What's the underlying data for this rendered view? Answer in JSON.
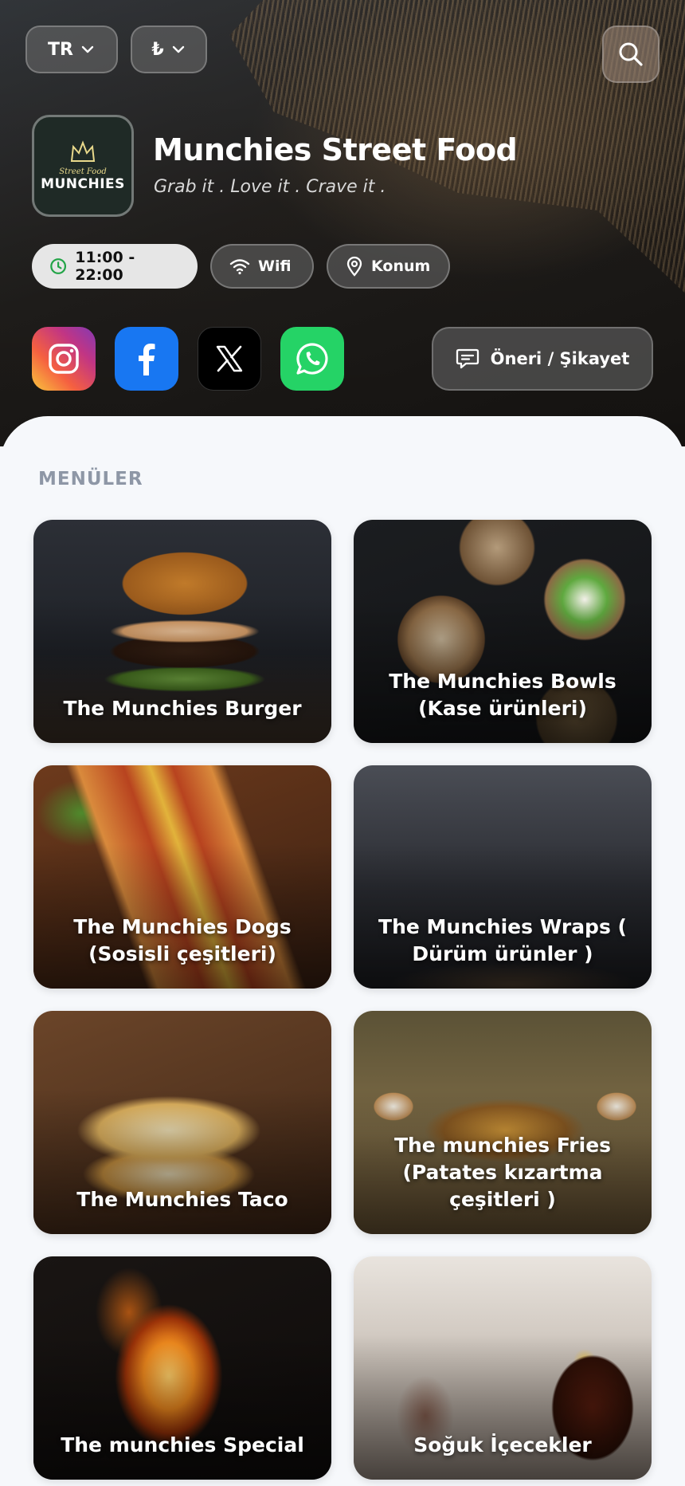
{
  "header": {
    "language_label": "TR",
    "currency_label": "₺",
    "restaurant_name": "Munchies Street Food",
    "tagline": "Grab it . Love it . Crave it .",
    "logo": {
      "small_text": "Street Food",
      "main_text": "MUNCHIES"
    }
  },
  "info_buttons": {
    "hours": "11:00 - 22:00",
    "wifi": "Wifi",
    "location": "Konum"
  },
  "social": {
    "icons": [
      "instagram-icon",
      "facebook-icon",
      "x-icon",
      "whatsapp-icon"
    ],
    "feedback_label": "Öneri / Şikayet"
  },
  "menu_section": {
    "title": "MENÜLER",
    "categories": [
      {
        "label": "The Munchies Burger"
      },
      {
        "label": "The Munchies Bowls (Kase ürünleri)"
      },
      {
        "label": "The Munchies Dogs (Sosisli çeşitleri)"
      },
      {
        "label": "The Munchies Wraps ( Dürüm ürünler )"
      },
      {
        "label": "The Munchies Taco"
      },
      {
        "label": "The munchies Fries (Patates kızartma çeşitleri )"
      },
      {
        "label": "The munchies Special"
      },
      {
        "label": "Soğuk İçecekler"
      }
    ]
  },
  "colors": {
    "page_background": "#f6f8fb",
    "section_title": "#8e97a6",
    "hours_icon": "#22a447",
    "facebook": "#1877f2",
    "whatsapp": "#25d366"
  }
}
